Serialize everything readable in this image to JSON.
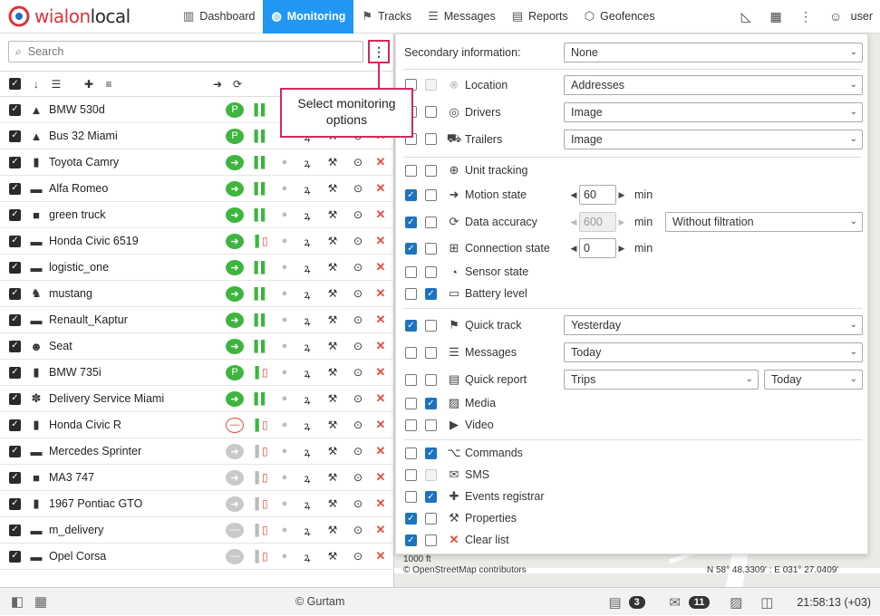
{
  "app": {
    "logo_text_a": "wialon",
    "logo_text_b": "local"
  },
  "nav": [
    {
      "label": "Dashboard",
      "icon": "bar-chart-icon"
    },
    {
      "label": "Monitoring",
      "icon": "globe-icon"
    },
    {
      "label": "Tracks",
      "icon": "checkered-flag-icon"
    },
    {
      "label": "Messages",
      "icon": "message-list-icon"
    },
    {
      "label": "Reports",
      "icon": "report-icon"
    },
    {
      "label": "Geofences",
      "icon": "geofence-icon"
    }
  ],
  "user": {
    "name": "user"
  },
  "search": {
    "placeholder": "Search"
  },
  "tooltip": {
    "text": "Select monitoring options"
  },
  "units": [
    {
      "name": "BMW 530d",
      "icon": "▲",
      "motion": "moving-parked",
      "signal": "green"
    },
    {
      "name": "Bus 32 Miami",
      "icon": "▲",
      "motion": "moving-parked",
      "signal": "green"
    },
    {
      "name": "Toyota Camry",
      "icon": "▮",
      "motion": "moving",
      "signal": "green"
    },
    {
      "name": "Alfa Romeo",
      "icon": "▬",
      "motion": "moving",
      "signal": "green"
    },
    {
      "name": "green truck",
      "icon": "■",
      "motion": "moving",
      "signal": "green"
    },
    {
      "name": "Honda Civic 6519",
      "icon": "▬",
      "motion": "moving",
      "signal": "red"
    },
    {
      "name": "logistic_one",
      "icon": "▬",
      "motion": "moving",
      "signal": "green"
    },
    {
      "name": "mustang",
      "icon": "♞",
      "motion": "moving",
      "signal": "green"
    },
    {
      "name": "Renault_Kaptur",
      "icon": "▬",
      "motion": "moving",
      "signal": "green"
    },
    {
      "name": "Seat",
      "icon": "☻",
      "motion": "moving",
      "signal": "green"
    },
    {
      "name": "BMW 735i",
      "icon": "▮",
      "motion": "moving-parked",
      "signal": "red"
    },
    {
      "name": "Delivery Service Miami",
      "icon": "✽",
      "motion": "moving",
      "signal": "green"
    },
    {
      "name": "Honda Civic R",
      "icon": "▮",
      "motion": "stopped",
      "signal": "red"
    },
    {
      "name": "Mercedes Sprinter",
      "icon": "▬",
      "motion": "grey",
      "signal": "grey-red"
    },
    {
      "name": "MA3 747",
      "icon": "■",
      "motion": "grey",
      "signal": "grey-red"
    },
    {
      "name": "1967 Pontiac GTO",
      "icon": "▮",
      "motion": "grey",
      "signal": "grey-red"
    },
    {
      "name": "m_delivery",
      "icon": "▬",
      "motion": "grey-stop",
      "signal": "grey-red"
    },
    {
      "name": "Opel Corsa",
      "icon": "▬",
      "motion": "grey-stop",
      "signal": "grey-red"
    }
  ],
  "panel": {
    "secondary_label": "Secondary information:",
    "secondary_value": "None",
    "location": {
      "label": "Location",
      "value": "Addresses"
    },
    "drivers": {
      "label": "Drivers",
      "value": "Image"
    },
    "trailers": {
      "label": "Trailers",
      "value": "Image"
    },
    "unit_tracking": {
      "label": "Unit tracking"
    },
    "motion_state": {
      "label": "Motion state",
      "value": "60",
      "unit": "min"
    },
    "data_accuracy": {
      "label": "Data accuracy",
      "value": "600",
      "unit": "min",
      "filter": "Without filtration"
    },
    "connection_state": {
      "label": "Connection state",
      "value": "0",
      "unit": "min"
    },
    "sensor_state": {
      "label": "Sensor state"
    },
    "battery_level": {
      "label": "Battery level"
    },
    "quick_track": {
      "label": "Quick track",
      "value": "Yesterday"
    },
    "messages": {
      "label": "Messages",
      "value": "Today"
    },
    "quick_report": {
      "label": "Quick report",
      "value": "Trips",
      "period": "Today"
    },
    "media": {
      "label": "Media"
    },
    "video": {
      "label": "Video"
    },
    "commands": {
      "label": "Commands"
    },
    "sms": {
      "label": "SMS"
    },
    "events_registrar": {
      "label": "Events registrar"
    },
    "properties": {
      "label": "Properties"
    },
    "clear_list": {
      "label": "Clear list"
    }
  },
  "map": {
    "scale": "1000 ft",
    "credit": "© OpenStreetMap contributors",
    "coords": "N 58° 48.3309' : E 031° 27.0409'"
  },
  "footer": {
    "copyright": "© Gurtam",
    "notifications_count": "3",
    "messages_count": "11",
    "time": "21:58:13 (+03)"
  },
  "colors": {
    "accent": "#2196f3",
    "highlight": "#d12a5a",
    "green": "#3db53f",
    "red": "#e74c3c"
  }
}
